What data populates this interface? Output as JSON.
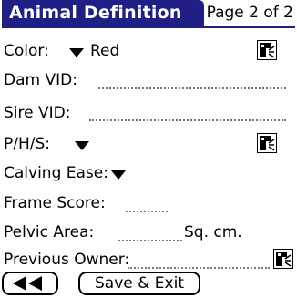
{
  "header": {
    "title": "Animal Definition",
    "page_indicator": "Page 2 of 2"
  },
  "fields": {
    "color": {
      "label": "Color:",
      "value": "Red"
    },
    "dam_vid": {
      "label": "Dam VID:",
      "value": ""
    },
    "sire_vid": {
      "label": "Sire VID:",
      "value": ""
    },
    "phs": {
      "label": "P/H/S:",
      "value": ""
    },
    "calving_ease": {
      "label": "Calving Ease:",
      "value": ""
    },
    "frame_score": {
      "label": "Frame Score:",
      "value": ""
    },
    "pelvic_area": {
      "label": "Pelvic Area:",
      "value": "",
      "unit": "Sq. cm."
    },
    "previous_owner": {
      "label": "Previous Owner:",
      "value": ""
    }
  },
  "buttons": {
    "save_exit": "Save & Exit"
  },
  "icons": {
    "lookup": "lookup-icon",
    "dropdown": "triangle-down-icon",
    "previous_page": "double-left-arrow-icon"
  },
  "colors": {
    "header_bg": "#1f1f86",
    "header_text": "#ffffff"
  }
}
